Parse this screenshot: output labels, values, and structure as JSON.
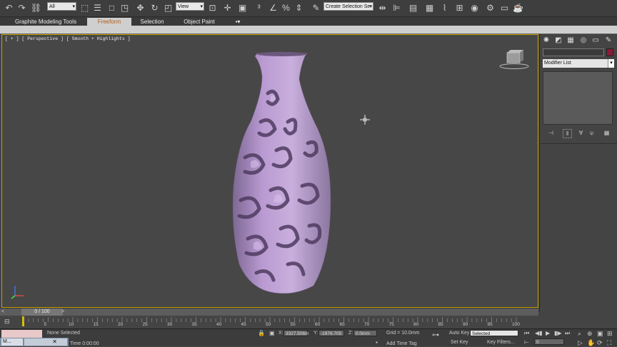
{
  "toolbar": {
    "selection_filter": "All",
    "ref_coord_system": "View",
    "named_selection": "Create Selection Se",
    "icons": [
      "undo-icon",
      "redo-icon",
      "link-icon",
      "unlink-icon",
      "bind-icon",
      "select-icon",
      "select-by-name-icon",
      "rect-select-icon",
      "window-crossing-icon",
      "move-icon",
      "rotate-icon",
      "scale-icon",
      "pivot-icon",
      "snaps-icon",
      "angle-snap-icon",
      "percent-snap-icon",
      "spinner-snap-icon",
      "edit-named-sets-icon",
      "mirror-icon",
      "align-icon",
      "layer-icon",
      "graphite-icon",
      "curve-editor-icon",
      "schematic-icon",
      "material-editor-icon",
      "render-setup-icon",
      "render-frame-icon",
      "render-icon",
      "teapot-icon"
    ]
  },
  "ribbon": {
    "tabs": [
      "Graphite Modeling Tools",
      "Freeform",
      "Selection",
      "Object Paint"
    ],
    "active_tab": "Freeform"
  },
  "viewport": {
    "label": "[ + ] [ Perspective ] [ Smooth + Highlights ]",
    "vase_color": "#a98fc0"
  },
  "command_panel": {
    "modifier_list": "Modifier List",
    "tabs": [
      "create-icon",
      "modify-icon",
      "hierarchy-icon",
      "motion-icon",
      "display-icon",
      "utilities-icon"
    ],
    "color_swatch": "#8a1a36"
  },
  "timeline": {
    "frame_display": "0 / 100",
    "ticks": [
      "5",
      "10",
      "15",
      "20",
      "25",
      "30",
      "35",
      "40",
      "45",
      "50",
      "55",
      "60",
      "65",
      "70",
      "75",
      "80",
      "85",
      "90",
      "95",
      "100"
    ]
  },
  "status": {
    "selection": "None Selected",
    "x_label": "X:",
    "x_value": "3327.506m",
    "y_label": "Y:",
    "y_value": "-1976.705",
    "z_label": "Z:",
    "z_value": "0.0mm",
    "grid": "Grid = 10.0mm",
    "auto_key": "Auto Key",
    "key_filter": "Selected",
    "set_key": "Set Key",
    "key_filters_btn": "Key Filters...",
    "time_text": "Time  0:00:00",
    "add_time_tag": "Add Time Tag",
    "current_frame": "0"
  },
  "taskbar": {
    "item_label": "M..."
  }
}
